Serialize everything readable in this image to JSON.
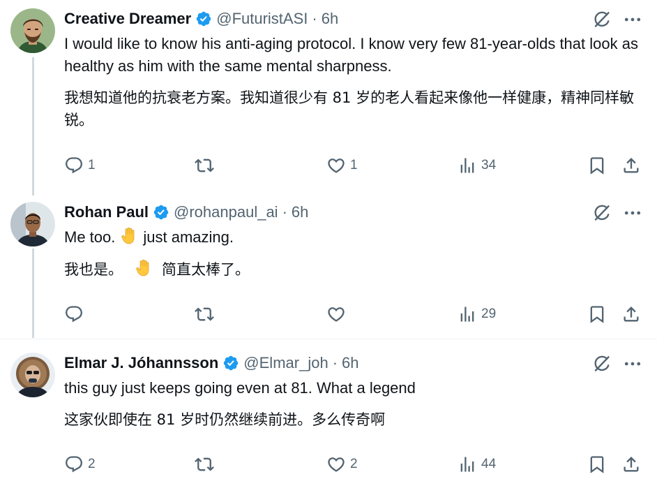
{
  "colors": {
    "verified": "#1d9bf0",
    "text_primary": "#0f1419",
    "text_secondary": "#536471",
    "thread_line": "#cfd9de",
    "divider": "#eff3f4"
  },
  "tweets": [
    {
      "name": "Creative Dreamer",
      "handle": "@FuturistASI",
      "dot": "·",
      "time": "6h",
      "text_en": "I would like to know his anti-aging protocol. I know very few 81-year-olds that look as healthy as him with the same mental sharpness.",
      "text_zh": "我想知道他的抗衰老方案。我知道很少有 81 岁的老人看起来像他一样健康，精神同样敏锐。",
      "replies": "1",
      "retweets": "",
      "likes": "1",
      "views": "34",
      "avatar_icon": "avatar-illustrated-man",
      "verified_icon": "verified-badge-icon"
    },
    {
      "name": "Rohan Paul",
      "handle": "@rohanpaul_ai",
      "dot": "·",
      "time": "6h",
      "text_en_before": "Me too.",
      "text_en_after": "just amazing.",
      "text_zh_before": "我也是。",
      "text_zh_after": "简直太棒了。",
      "emoji": "raised-hand-emoji",
      "replies": "",
      "retweets": "",
      "likes": "",
      "views": "29",
      "avatar_icon": "avatar-photo-man",
      "verified_icon": "verified-badge-icon"
    },
    {
      "name": "Elmar J. Jóhannsson",
      "handle": "@Elmar_joh",
      "dot": "·",
      "time": "6h",
      "text_en": "this guy just keeps going even at 81. What a legend",
      "text_zh": "这家伙即使在 81 岁时仍然继续前进。多么传奇啊",
      "replies": "2",
      "retweets": "",
      "likes": "2",
      "views": "44",
      "avatar_icon": "avatar-photo-fur-hood",
      "verified_icon": "verified-badge-icon"
    }
  ]
}
